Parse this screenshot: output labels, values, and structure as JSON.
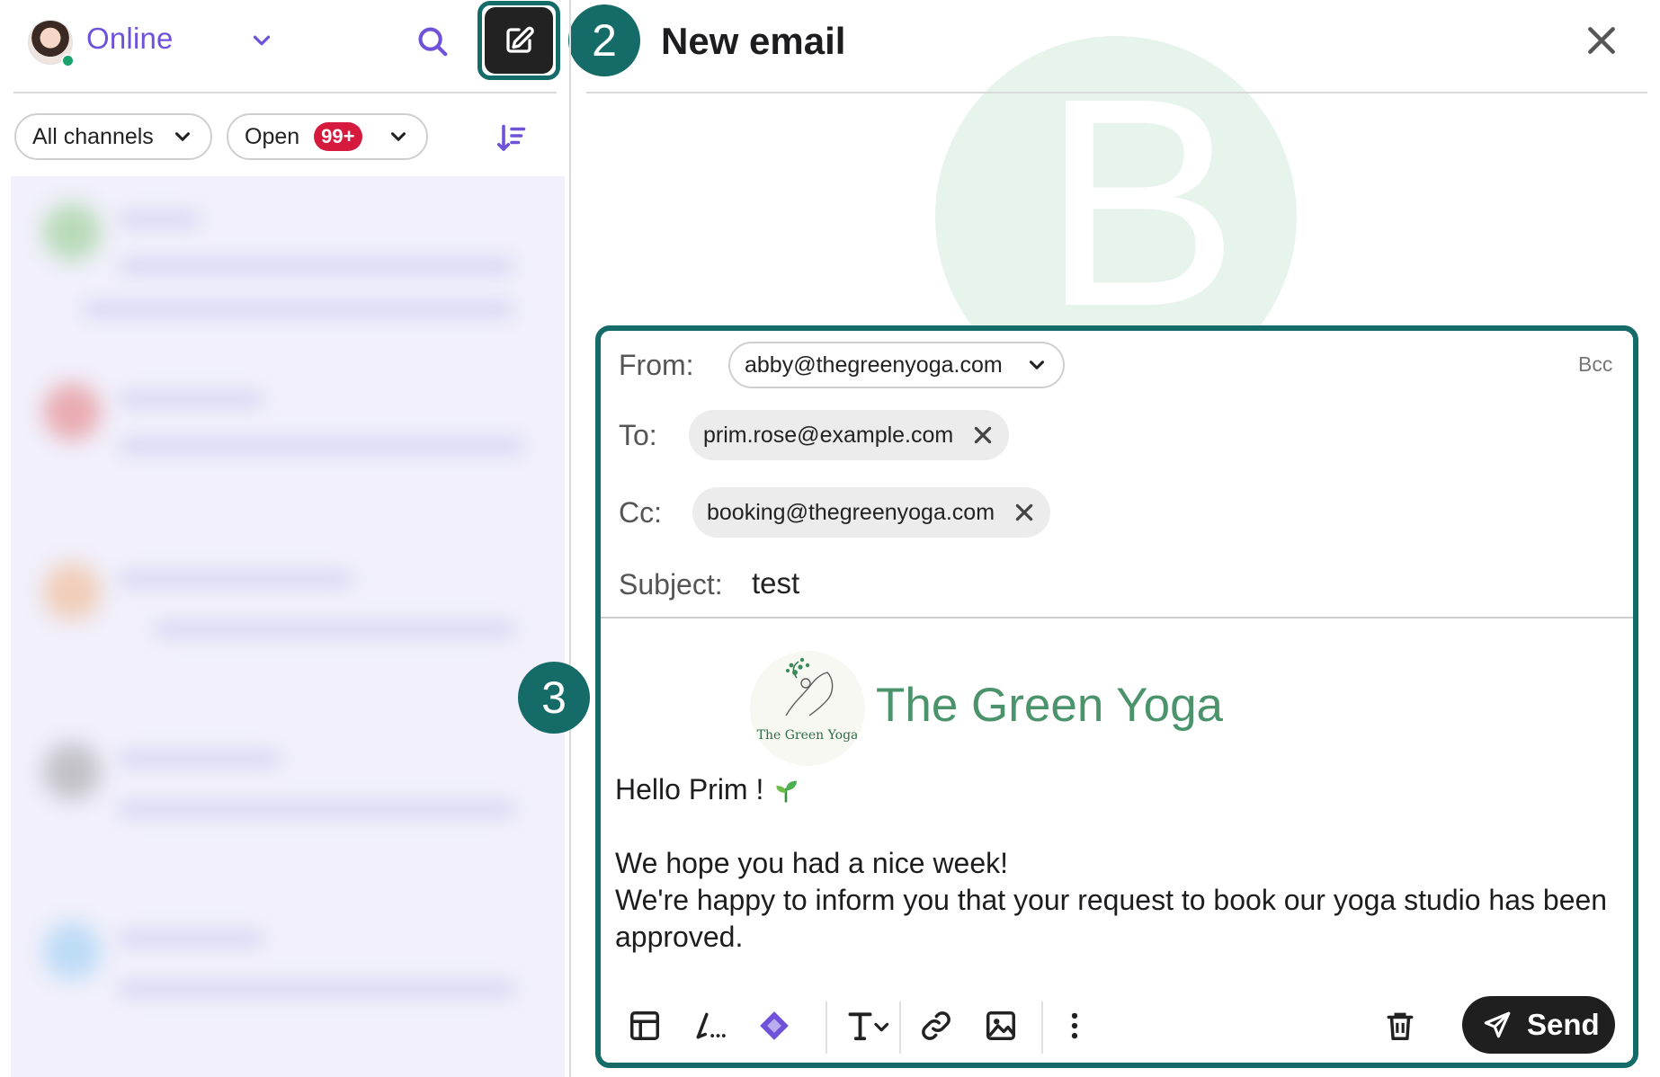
{
  "sidebar": {
    "status": "Online",
    "filter_channels": "All channels",
    "filter_status": "Open",
    "filter_status_count": "99+"
  },
  "steps": {
    "compose": "2",
    "form": "3"
  },
  "compose": {
    "title": "New email",
    "bg_logo_letter": "B",
    "from_label": "From:",
    "from_value": "abby@thegreenyoga.com",
    "bcc_label": "Bcc",
    "to_label": "To:",
    "to_value": "prim.rose@example.com",
    "cc_label": "Cc:",
    "cc_value": "booking@thegreenyoga.com",
    "subject_label": "Subject:",
    "subject_value": "test",
    "logo_caption": "The Green Yoga",
    "brand_name": "The Green Yoga",
    "body_greeting": "Hello Prim ! ",
    "body_line1": "We hope you had a nice week!",
    "body_line2": "We're happy to inform you that your request to book our yoga studio has been",
    "body_line3": "approved.",
    "send_label": "Send"
  },
  "colors": {
    "accent_teal": "#146b67",
    "status_purple": "#6f52d9",
    "badge_red": "#d51a3d",
    "brand_green": "#4a936b"
  },
  "icons": [
    "chevron-down-icon",
    "search-icon",
    "compose-icon",
    "sort-icon",
    "close-icon",
    "template-icon",
    "signature-icon",
    "ai-icon",
    "text-format-icon",
    "link-icon",
    "image-icon",
    "more-icon",
    "trash-icon",
    "send-icon",
    "sprout-icon"
  ]
}
